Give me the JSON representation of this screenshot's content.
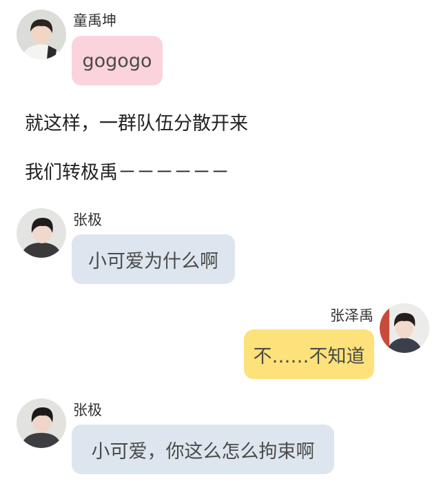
{
  "messages": [
    {
      "sender": "童禹坤",
      "text": "gogogo",
      "side": "left",
      "bubble_color": "#fbd3dc"
    },
    {
      "sender": "张极",
      "text": "小可爱为什么啊",
      "side": "left",
      "bubble_color": "#dde6ee"
    },
    {
      "sender": "张泽禹",
      "text": "不……不知道",
      "side": "right",
      "bubble_color": "#fde17a"
    },
    {
      "sender": "张极",
      "text": "小可爱，你这么怎么拘束啊",
      "side": "left",
      "bubble_color": "#dde6ee"
    }
  ],
  "narration": [
    "就这样，一群队伍分散开来",
    "我们转极禹－－－－－－"
  ]
}
